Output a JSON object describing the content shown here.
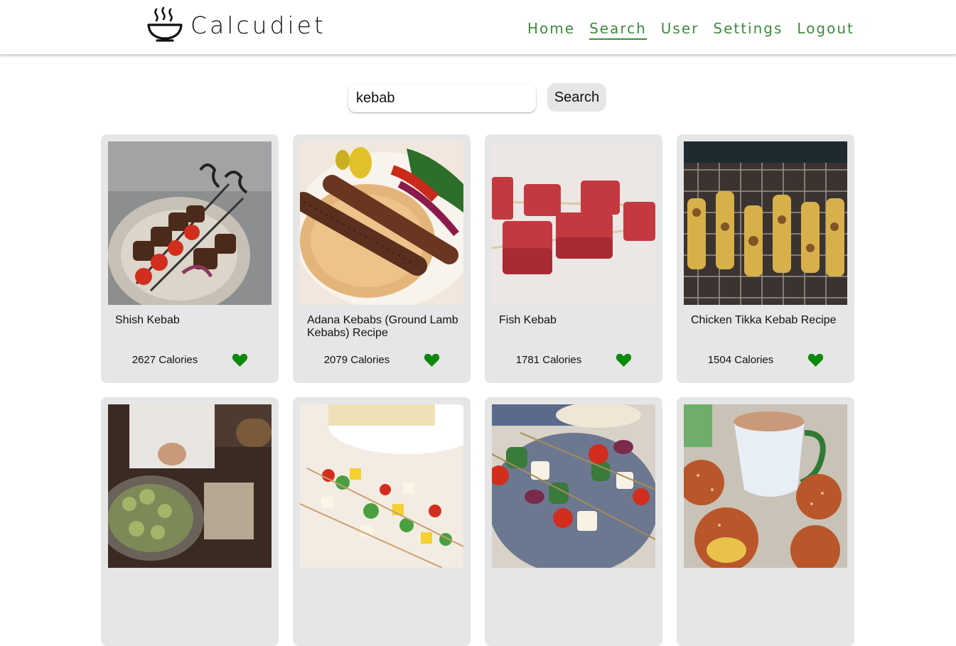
{
  "header": {
    "brand_name": "Calcudiet",
    "nav": [
      {
        "label": "Home",
        "active": false
      },
      {
        "label": "Search",
        "active": true
      },
      {
        "label": "User",
        "active": false
      },
      {
        "label": "Settings",
        "active": false
      },
      {
        "label": "Logout",
        "active": false
      }
    ]
  },
  "search": {
    "value": "kebab",
    "button_label": "Search"
  },
  "colors": {
    "accent_green": "#3f8a3f",
    "heart_green": "#0a8a0a",
    "card_bg": "#e6e6e6"
  },
  "results": [
    {
      "title": "Shish Kebab",
      "calories": "2627 Calories",
      "image": "grilled-meat-skewers-photo",
      "favorite_icon": "heart-icon"
    },
    {
      "title": "Adana Kebabs (Ground Lamb Kebabs) Recipe",
      "calories": "2079 Calories",
      "image": "ground-lamb-kebabs-photo",
      "favorite_icon": "heart-icon"
    },
    {
      "title": "Fish Kebab",
      "calories": "1781 Calories",
      "image": "raw-fish-cubes-skewers-photo",
      "favorite_icon": "heart-icon"
    },
    {
      "title": "Chicken Tikka Kebab Recipe",
      "calories": "1504 Calories",
      "image": "chicken-tikka-grill-photo",
      "favorite_icon": "heart-icon"
    },
    {
      "title": "",
      "calories": "",
      "image": "chef-cooking-kebabs-photo",
      "favorite_icon": "heart-icon"
    },
    {
      "title": "",
      "calories": "",
      "image": "vegetable-halloumi-skewers-photo",
      "favorite_icon": "heart-icon"
    },
    {
      "title": "",
      "calories": "",
      "image": "veggie-skewers-plate-photo",
      "favorite_icon": "heart-icon"
    },
    {
      "title": "",
      "calories": "",
      "image": "tea-cup-and-buns-photo",
      "favorite_icon": "heart-icon"
    }
  ]
}
